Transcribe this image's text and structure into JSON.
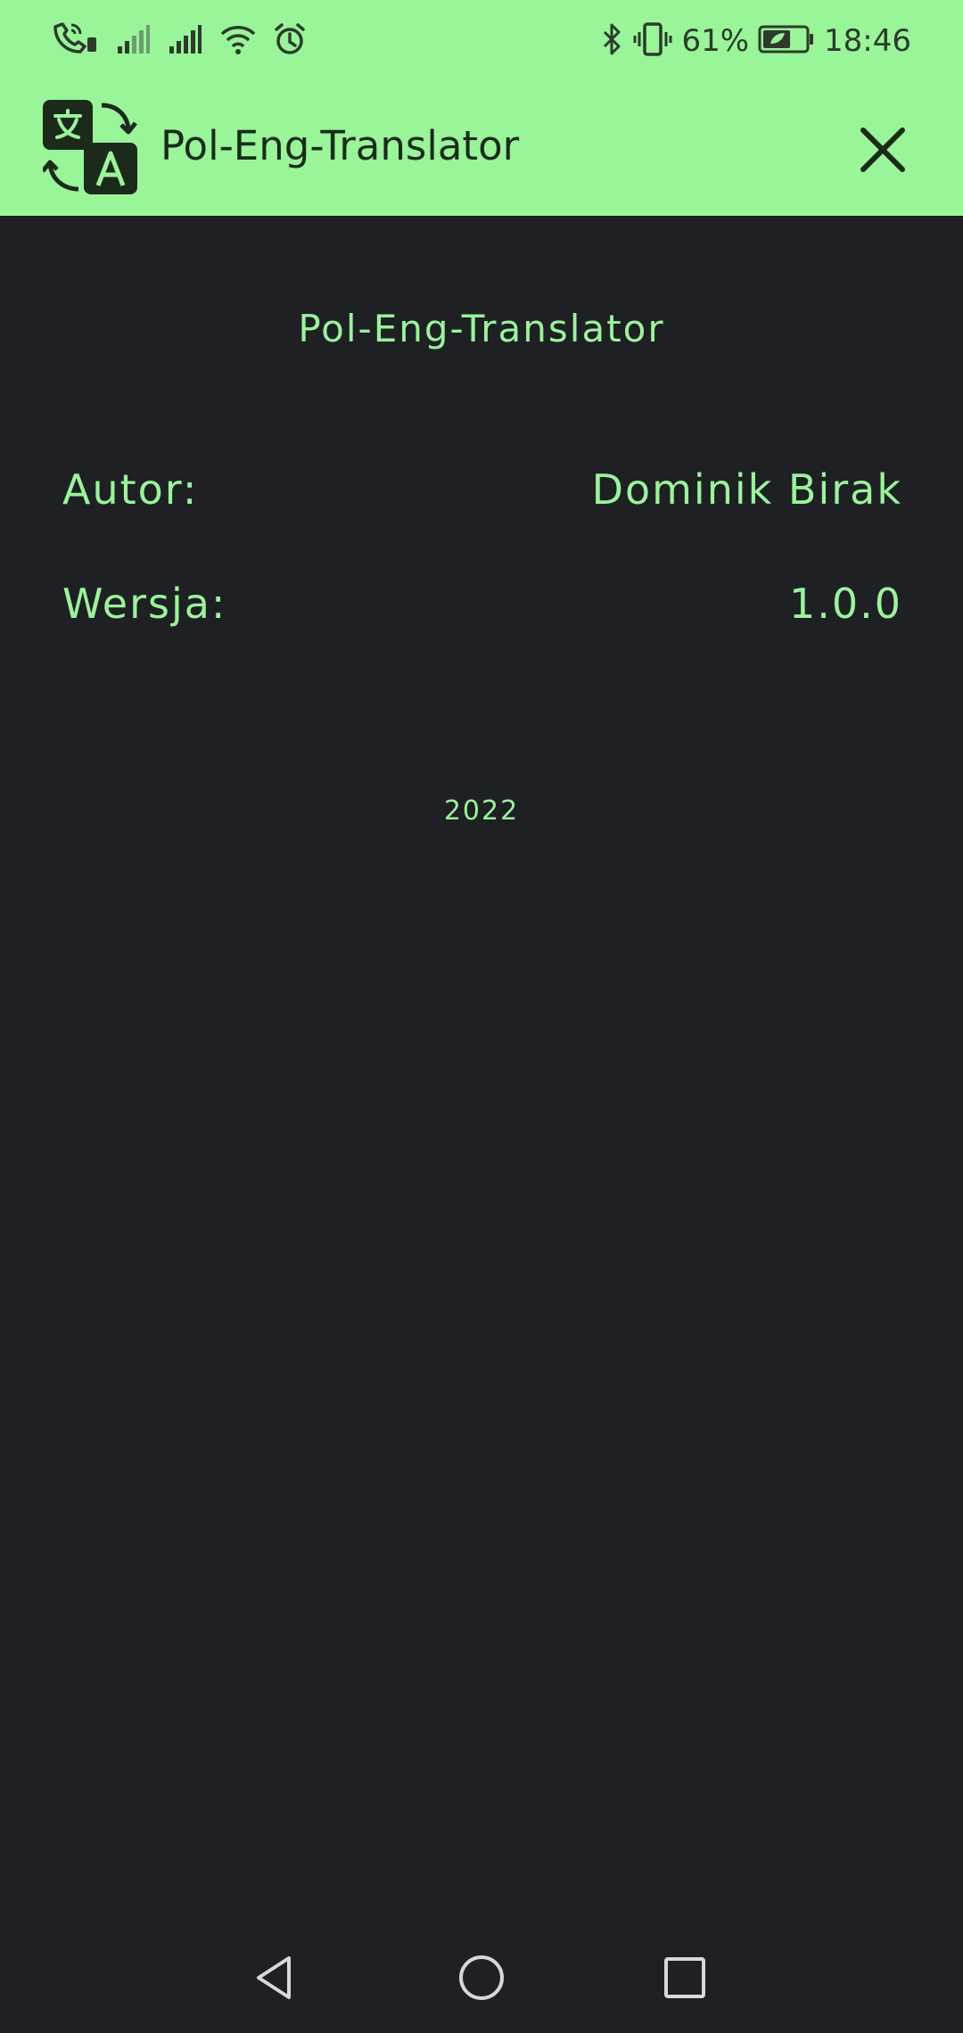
{
  "status_bar": {
    "battery_percent": "61%",
    "time": "18:46",
    "icons": [
      "wifi-calling-icon",
      "signal-icon",
      "signal-icon",
      "wifi-icon",
      "alarm-icon",
      "bluetooth-icon",
      "vibrate-icon",
      "battery-icon"
    ]
  },
  "app_bar": {
    "title": "Pol-Eng-Translator",
    "logo_icon": "translate-icon",
    "close_icon": "close-icon"
  },
  "about": {
    "title": "Pol-Eng-Translator",
    "author_label": "Autor:",
    "author_value": "Dominik Birak",
    "version_label": "Wersja:",
    "version_value": "1.0.0",
    "year": "2022"
  },
  "nav_bar": {
    "icons": [
      "back-icon",
      "home-icon",
      "recent-apps-icon"
    ]
  },
  "colors": {
    "accent": "#98f598",
    "background": "#1f2024",
    "header_text": "#1c2a1c"
  }
}
